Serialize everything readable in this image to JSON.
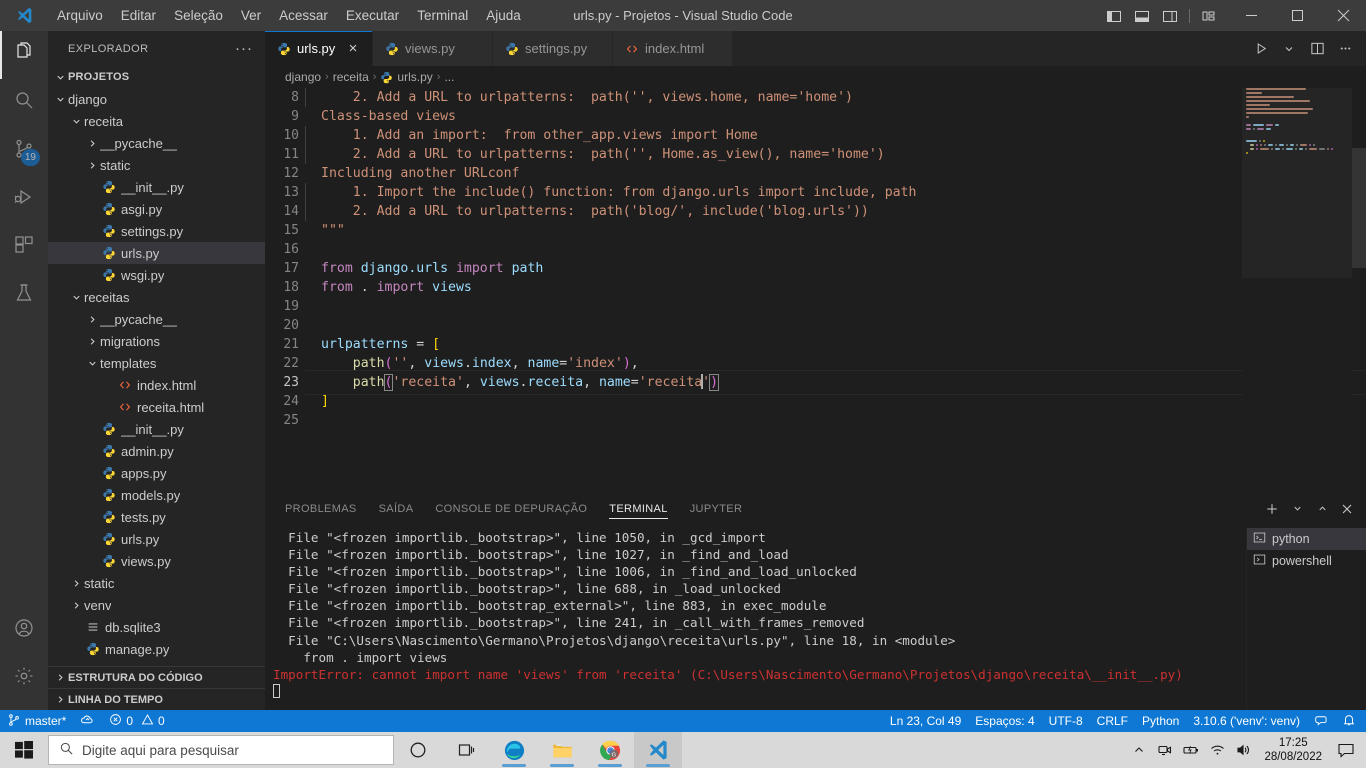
{
  "window": {
    "title": "urls.py - Projetos - Visual Studio Code",
    "menu": [
      "Arquivo",
      "Editar",
      "Seleção",
      "Ver",
      "Acessar",
      "Executar",
      "Terminal",
      "Ajuda"
    ],
    "layout_buttons": [
      "toggle-primary-sidebar",
      "toggle-panel",
      "toggle-secondary-sidebar",
      "customize-layout"
    ],
    "controls": [
      "minimize",
      "maximize",
      "close"
    ]
  },
  "activitybar": {
    "items": [
      {
        "name": "explorer",
        "icon": "files-icon",
        "badge": ""
      },
      {
        "name": "search",
        "icon": "search-icon",
        "badge": ""
      },
      {
        "name": "source-control",
        "icon": "source-control-icon",
        "badge": "19"
      },
      {
        "name": "run-debug",
        "icon": "run-debug-icon",
        "badge": ""
      },
      {
        "name": "extensions",
        "icon": "extensions-icon",
        "badge": ""
      },
      {
        "name": "testing",
        "icon": "beaker-icon",
        "badge": ""
      }
    ],
    "bottom": [
      {
        "name": "accounts",
        "icon": "account-icon"
      },
      {
        "name": "settings",
        "icon": "gear-icon"
      }
    ]
  },
  "sidebar": {
    "header": "EXPLORADOR",
    "more_actions": "···",
    "root": "PROJETOS",
    "tree": [
      {
        "label": "django",
        "indent": 1,
        "type": "folder",
        "state": "open"
      },
      {
        "label": "receita",
        "indent": 2,
        "type": "folder",
        "state": "open"
      },
      {
        "label": "__pycache__",
        "indent": 3,
        "type": "folder",
        "state": "closed"
      },
      {
        "label": "static",
        "indent": 3,
        "type": "folder",
        "state": "closed"
      },
      {
        "label": "__init__.py",
        "indent": 3,
        "type": "python"
      },
      {
        "label": "asgi.py",
        "indent": 3,
        "type": "python"
      },
      {
        "label": "settings.py",
        "indent": 3,
        "type": "python"
      },
      {
        "label": "urls.py",
        "indent": 3,
        "type": "python",
        "selected": true
      },
      {
        "label": "wsgi.py",
        "indent": 3,
        "type": "python"
      },
      {
        "label": "receitas",
        "indent": 2,
        "type": "folder",
        "state": "open"
      },
      {
        "label": "__pycache__",
        "indent": 3,
        "type": "folder",
        "state": "closed"
      },
      {
        "label": "migrations",
        "indent": 3,
        "type": "folder",
        "state": "closed"
      },
      {
        "label": "templates",
        "indent": 3,
        "type": "folder",
        "state": "open"
      },
      {
        "label": "index.html",
        "indent": 4,
        "type": "html"
      },
      {
        "label": "receita.html",
        "indent": 4,
        "type": "html"
      },
      {
        "label": "__init__.py",
        "indent": 3,
        "type": "python"
      },
      {
        "label": "admin.py",
        "indent": 3,
        "type": "python"
      },
      {
        "label": "apps.py",
        "indent": 3,
        "type": "python"
      },
      {
        "label": "models.py",
        "indent": 3,
        "type": "python"
      },
      {
        "label": "tests.py",
        "indent": 3,
        "type": "python"
      },
      {
        "label": "urls.py",
        "indent": 3,
        "type": "python"
      },
      {
        "label": "views.py",
        "indent": 3,
        "type": "python"
      },
      {
        "label": "static",
        "indent": 2,
        "type": "folder",
        "state": "closed"
      },
      {
        "label": "venv",
        "indent": 2,
        "type": "folder",
        "state": "closed"
      },
      {
        "label": "db.sqlite3",
        "indent": 2,
        "type": "db"
      },
      {
        "label": "manage.py",
        "indent": 2,
        "type": "python"
      }
    ],
    "sections": [
      "ESTRUTURA DO CÓDIGO",
      "LINHA DO TEMPO"
    ]
  },
  "editor": {
    "tabs": [
      {
        "label": "urls.py",
        "type": "python",
        "active": true,
        "close": "×"
      },
      {
        "label": "views.py",
        "type": "python",
        "active": false
      },
      {
        "label": "settings.py",
        "type": "python",
        "active": false
      },
      {
        "label": "index.html",
        "type": "html",
        "active": false
      }
    ],
    "actions": [
      "run-python-file-button",
      "chevron-down-icon",
      "split-editor-button",
      "more-actions-icon"
    ],
    "breadcrumbs": [
      "django",
      "receita",
      "urls.py",
      "..."
    ],
    "first_line_number": 8,
    "lines": [
      {
        "n": 8,
        "segments": [
          {
            "t": "    2. Add a URL to urlpatterns:  path('', views.home, name='home')",
            "c": "t-doc"
          }
        ]
      },
      {
        "n": 9,
        "segments": [
          {
            "t": "Class-based views",
            "c": "t-doc"
          }
        ]
      },
      {
        "n": 10,
        "segments": [
          {
            "t": "    1. Add an import:  from other_app.views import Home",
            "c": "t-doc"
          }
        ]
      },
      {
        "n": 11,
        "segments": [
          {
            "t": "    2. Add a URL to urlpatterns:  path('', Home.as_view(), name='home')",
            "c": "t-doc"
          }
        ]
      },
      {
        "n": 12,
        "segments": [
          {
            "t": "Including another URLconf",
            "c": "t-doc"
          }
        ]
      },
      {
        "n": 13,
        "segments": [
          {
            "t": "    1. Import the include() function: from django.urls import include, path",
            "c": "t-doc"
          }
        ]
      },
      {
        "n": 14,
        "segments": [
          {
            "t": "    2. Add a URL to urlpatterns:  path('blog/', include('blog.urls'))",
            "c": "t-doc"
          }
        ]
      },
      {
        "n": 15,
        "segments": [
          {
            "t": "\"\"\"",
            "c": "t-doc"
          }
        ]
      },
      {
        "n": 16,
        "segments": []
      },
      {
        "n": 17,
        "segments": [
          {
            "t": "from ",
            "c": "t-kw"
          },
          {
            "t": "django.urls ",
            "c": "t-var"
          },
          {
            "t": "import ",
            "c": "t-kw"
          },
          {
            "t": "path",
            "c": "t-var"
          }
        ]
      },
      {
        "n": 18,
        "segments": [
          {
            "t": "from ",
            "c": "t-kw"
          },
          {
            "t": ". ",
            "c": "t-plain"
          },
          {
            "t": "import ",
            "c": "t-kw"
          },
          {
            "t": "views",
            "c": "t-var"
          }
        ]
      },
      {
        "n": 19,
        "segments": []
      },
      {
        "n": 20,
        "segments": []
      },
      {
        "n": 21,
        "segments": [
          {
            "t": "urlpatterns ",
            "c": "t-var"
          },
          {
            "t": "= ",
            "c": "t-plain"
          },
          {
            "t": "[",
            "c": "t-br1"
          }
        ]
      },
      {
        "n": 22,
        "segments": [
          {
            "t": "    ",
            "c": "t-plain"
          },
          {
            "t": "path",
            "c": "t-fn"
          },
          {
            "t": "(",
            "c": "t-br2"
          },
          {
            "t": "''",
            "c": "t-str"
          },
          {
            "t": ", ",
            "c": "t-plain"
          },
          {
            "t": "views",
            "c": "t-var"
          },
          {
            "t": ".",
            "c": "t-plain"
          },
          {
            "t": "index",
            "c": "t-var"
          },
          {
            "t": ", ",
            "c": "t-plain"
          },
          {
            "t": "name",
            "c": "t-var"
          },
          {
            "t": "=",
            "c": "t-plain"
          },
          {
            "t": "'index'",
            "c": "t-str"
          },
          {
            "t": ")",
            "c": "t-br2"
          },
          {
            "t": ",",
            "c": "t-plain"
          }
        ]
      },
      {
        "n": 23,
        "current": true,
        "segments": [
          {
            "t": "    ",
            "c": "t-plain"
          },
          {
            "t": "path",
            "c": "t-fn"
          },
          {
            "t": "(",
            "c": "t-br2",
            "hl": true
          },
          {
            "t": "'receita'",
            "c": "t-str"
          },
          {
            "t": ", ",
            "c": "t-plain"
          },
          {
            "t": "views",
            "c": "t-var"
          },
          {
            "t": ".",
            "c": "t-plain"
          },
          {
            "t": "receita",
            "c": "t-var"
          },
          {
            "t": ", ",
            "c": "t-plain"
          },
          {
            "t": "name",
            "c": "t-var"
          },
          {
            "t": "=",
            "c": "t-plain"
          },
          {
            "t": "'receita",
            "c": "t-str"
          },
          {
            "t": "CURSOR",
            "c": "cursor"
          },
          {
            "t": "'",
            "c": "t-str"
          },
          {
            "t": ")",
            "c": "t-br2",
            "hl": true
          }
        ]
      },
      {
        "n": 24,
        "segments": [
          {
            "t": "]",
            "c": "t-br1"
          }
        ]
      },
      {
        "n": 25,
        "segments": []
      }
    ]
  },
  "panel": {
    "tabs": [
      "PROBLEMAS",
      "SAÍDA",
      "CONSOLE DE DEPURAÇÃO",
      "TERMINAL",
      "JUPYTER"
    ],
    "active_tab": "TERMINAL",
    "actions": [
      "new-terminal-button",
      "chevron-down-icon",
      "maximize-panel-icon",
      "close-panel-icon"
    ],
    "terminal_lines": [
      {
        "text": "  File \"<frozen importlib._bootstrap>\", line 1050, in _gcd_import",
        "error": false
      },
      {
        "text": "  File \"<frozen importlib._bootstrap>\", line 1027, in _find_and_load",
        "error": false
      },
      {
        "text": "  File \"<frozen importlib._bootstrap>\", line 1006, in _find_and_load_unlocked",
        "error": false
      },
      {
        "text": "  File \"<frozen importlib._bootstrap>\", line 688, in _load_unlocked",
        "error": false
      },
      {
        "text": "  File \"<frozen importlib._bootstrap_external>\", line 883, in exec_module",
        "error": false
      },
      {
        "text": "  File \"<frozen importlib._bootstrap>\", line 241, in _call_with_frames_removed",
        "error": false
      },
      {
        "text": "  File \"C:\\Users\\Nascimento\\Germano\\Projetos\\django\\receita\\urls.py\", line 18, in <module>",
        "error": false
      },
      {
        "text": "    from . import views",
        "error": false
      },
      {
        "text": "ImportError: cannot import name 'views' from 'receita' (C:\\Users\\Nascimento\\Germano\\Projetos\\django\\receita\\__init__.py)",
        "error": true
      }
    ],
    "terminal_instances": [
      {
        "label": "python",
        "icon": "terminal-python-icon",
        "active": true
      },
      {
        "label": "powershell",
        "icon": "terminal-powershell-icon",
        "active": false
      }
    ]
  },
  "statusbar": {
    "branch": "master*",
    "sync_icon": "sync-cloud-icon",
    "errors": "0",
    "warnings": "0",
    "position": "Ln 23, Col 49",
    "spaces": "Espaços: 4",
    "encoding": "UTF-8",
    "eol": "CRLF",
    "language": "Python",
    "interpreter": "3.10.6 ('venv': venv)",
    "feedback_icon": "smiley-feedback-icon",
    "bell_icon": "bell-icon",
    "accent": "#0e78d4"
  },
  "taskbar": {
    "start_icon": "windows-start-icon",
    "search_placeholder": "Digite aqui para pesquisar",
    "pinned": [
      {
        "name": "cortana-icon"
      },
      {
        "name": "task-view-icon"
      },
      {
        "name": "microsoft-edge-icon",
        "running": true
      },
      {
        "name": "file-explorer-icon",
        "running": true
      },
      {
        "name": "google-chrome-icon",
        "running": true
      },
      {
        "name": "visual-studio-code-icon",
        "running": true,
        "active": true
      }
    ],
    "tray": [
      "show-hidden-icons",
      "camera-icon",
      "battery-icon",
      "wifi-icon",
      "volume-icon"
    ],
    "time": "17:25",
    "date": "28/08/2022",
    "action_center_icon": "action-center-icon"
  }
}
